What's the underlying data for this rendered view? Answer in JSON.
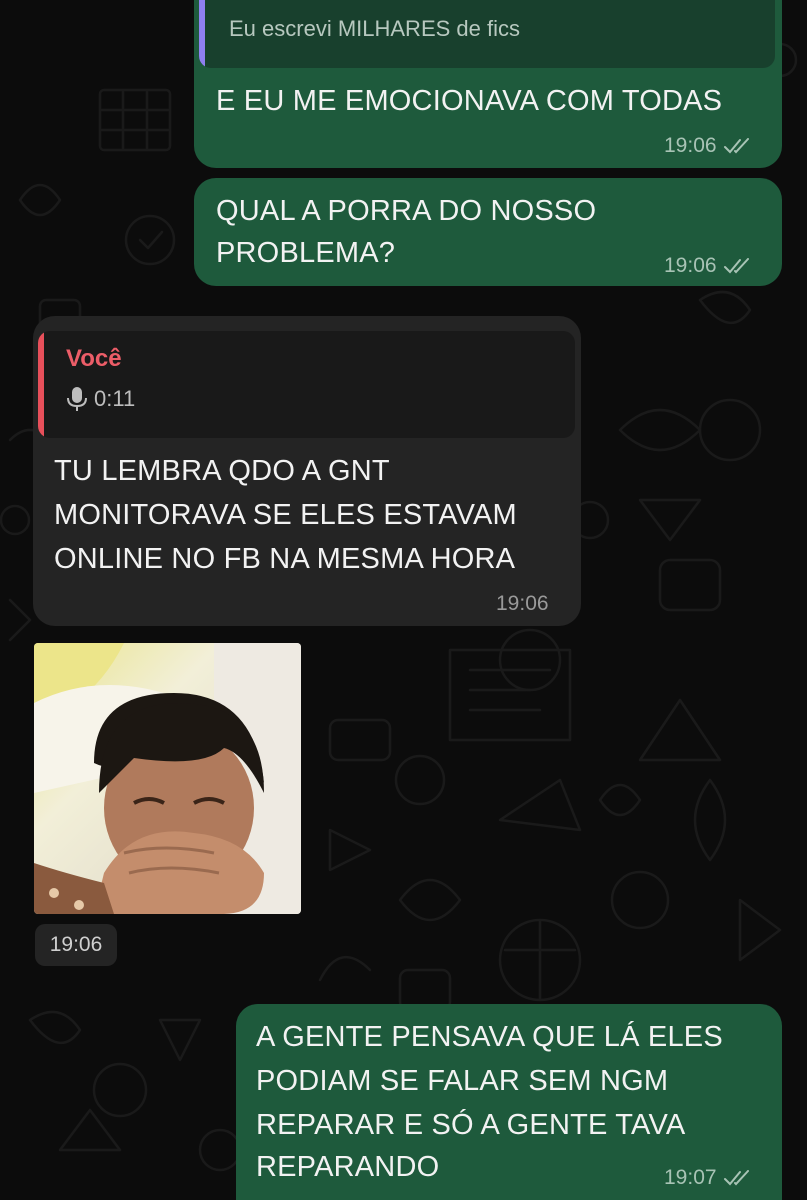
{
  "chat": {
    "messages": [
      {
        "direction": "outgoing",
        "quote_text": "Eu escrevi MILHARES de fics",
        "text": "E EU ME EMOCIONAVA COM TODAS",
        "time": "19:06",
        "status": "read"
      },
      {
        "direction": "outgoing",
        "lines": [
          "QUAL A PORRA DO NOSSO",
          "PROBLEMA?"
        ],
        "time": "19:06",
        "status": "read"
      },
      {
        "direction": "incoming",
        "reply": {
          "author": "Você",
          "type": "voice",
          "duration": "0:11",
          "icon": "microphone-icon"
        },
        "lines": [
          "TU LEMBRA QDO A GNT",
          "MONITORAVA SE ELES ESTAVAM",
          "ONLINE NO FB NA MESMA HORA"
        ],
        "time": "19:06"
      },
      {
        "direction": "incoming",
        "type": "image",
        "time": "19:06"
      },
      {
        "direction": "outgoing",
        "lines": [
          "A GENTE PENSAVA QUE LÁ ELES",
          "PODIAM SE FALAR SEM NGM",
          "REPARAR E SÓ A GENTE TAVA",
          "REPARANDO"
        ],
        "time": "19:07",
        "status": "read"
      }
    ]
  },
  "colors": {
    "background": "#0c0c0c",
    "outgoing_bubble": "#1e5a3c",
    "incoming_bubble": "#242424",
    "reply_author": "#ec5d68",
    "quote_bar_top": "#8f7ff0"
  }
}
